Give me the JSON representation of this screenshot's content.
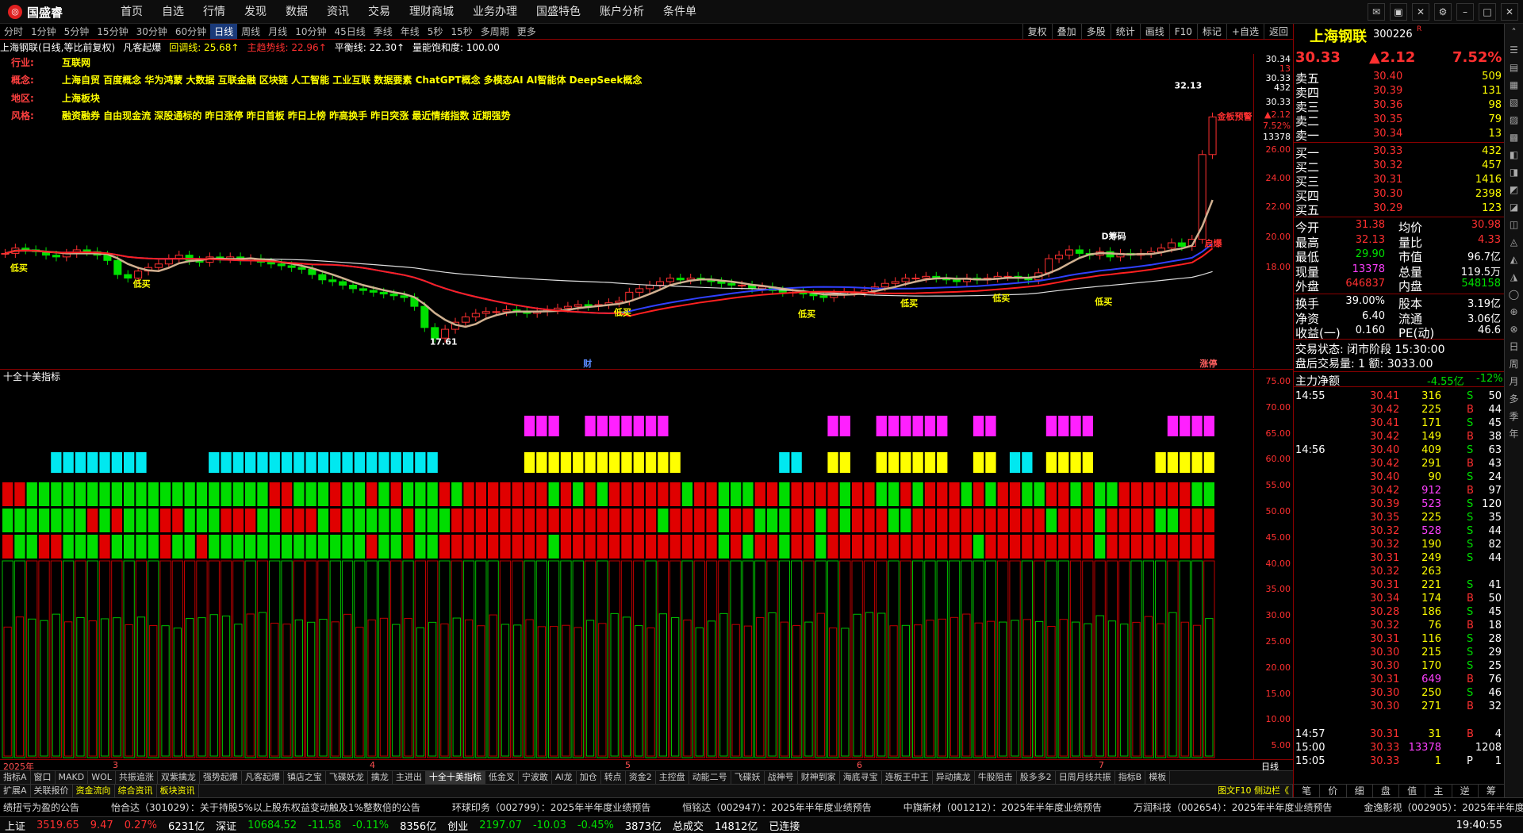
{
  "app": {
    "logo": "国盛睿",
    "menu": [
      "首页",
      "自选",
      "行情",
      "发现",
      "数据",
      "资讯",
      "交易",
      "理财商城",
      "业务办理",
      "国盛特色",
      "账户分析",
      "条件单"
    ]
  },
  "periods": [
    "分时",
    "1分钟",
    "5分钟",
    "15分钟",
    "30分钟",
    "60分钟",
    "日线",
    "周线",
    "月线",
    "10分钟",
    "45日线",
    "季线",
    "年线",
    "5秒",
    "15秒",
    "多周期",
    "更多"
  ],
  "active_period": "日线",
  "right_buttons": [
    "复权",
    "叠加",
    "多股",
    "统计",
    "画线",
    "F10",
    "标记",
    "+自选",
    "返回"
  ],
  "chart_header": {
    "title": "上海钢联(日线,等比前复权)",
    "indicator": "凡客起爆",
    "line1": "回调线: 25.68↑",
    "line2": "主趋势线: 22.96↑",
    "line3": "平衡线: 22.30↑",
    "line4": "量能饱和度: 100.00"
  },
  "info": [
    {
      "label": "行业:",
      "value": "互联网"
    },
    {
      "label": "概念:",
      "value": "上海自贸 百度概念 华为鸿蒙 大数据 互联金融 区块链 人工智能 工业互联 数据要素 ChatGPT概念 多模态AI AI智能体 DeepSeek概念"
    },
    {
      "label": "地区:",
      "value": "上海板块"
    },
    {
      "label": "风格:",
      "value": "融资融券 自由现金流 深股通标的 昨日涨停 昨日首板 昨日上榜 昨高换手 昨日突涨 最近情绪指数 近期强势"
    }
  ],
  "chart_annotations": {
    "high": "32.13",
    "low": "17.61",
    "buy": "低买",
    "chip": "D筹码",
    "start": "启爆",
    "warn": "金板预警",
    "cai": "财",
    "zhang": "涨停"
  },
  "main_axis": [
    "30.34",
    "13",
    "30.33",
    "432",
    "30.33",
    "▲2.12",
    "7.52%",
    "13378",
    "26.00",
    "24.00",
    "22.00",
    "20.00",
    "18.00"
  ],
  "ind_title": "十全十美指标",
  "ind_axis": [
    "75.00",
    "70.00",
    "65.00",
    "60.00",
    "55.00",
    "50.00",
    "45.00",
    "40.00",
    "35.00",
    "30.00",
    "25.00",
    "20.00",
    "15.00",
    "10.00",
    "5.00"
  ],
  "time_axis": [
    "2025年",
    "3",
    "4",
    "5",
    "6",
    "7"
  ],
  "time_right": "日线",
  "bottom_tabs": [
    "指标A",
    "窗口",
    "MAKD",
    "WOL",
    "共振追涨",
    "双紫擒龙",
    "强势起爆",
    "凡客起爆",
    "镇店之宝",
    "飞碟妖龙",
    "擒龙",
    "主进出",
    "十全十美指标",
    "低金叉",
    "宁波敢",
    "AI龙",
    "加仓",
    "转点",
    "资金2",
    "主控盘",
    "动能二号",
    "飞碟妖",
    "战神号",
    "财神到家",
    "海底寻宝",
    "连板王中王",
    "异动擒龙",
    "牛股阻击",
    "股多多2",
    "日周月线共振",
    "指标B",
    "模板"
  ],
  "bottom_tabs_active": "十全十美指标",
  "bottom_tabs2": [
    "扩展A",
    "关联报价",
    "资金流向",
    "综合资讯",
    "板块资讯"
  ],
  "bottom_right": "图文F10 侧边栏《",
  "ticker": [
    "绩扭亏为盈的公告",
    "怡合达（301029）：关于持股5%以上股东权益变动触及1%整数倍的公告",
    "环球印务（002799）：2025年半年度业绩预告",
    "恒铭达（002947）：2025年半年度业绩预告",
    "中旗新材（001212）：2025年半年度业绩预告",
    "万润科技（002654）：2025年半年度业绩预告",
    "金逸影视（002905）：2025年半年度业绩预告"
  ],
  "status": {
    "sh_label": "上证",
    "sh_val": "3519.65",
    "sh_chg": "9.47",
    "sh_pct": "0.27%",
    "sh_amt": "6231亿",
    "sz_label": "深证",
    "sz_val": "10684.52",
    "sz_chg": "-11.58",
    "sz_pct": "-0.11%",
    "sz_amt": "8356亿",
    "cy_label": "创业",
    "cy_val": "2197.07",
    "cy_chg": "-10.03",
    "cy_pct": "-0.45%",
    "cy_amt": "3873亿",
    "total_label": "总成交",
    "total_val": "14812亿",
    "conn": "已连接",
    "time": "19:40:55"
  },
  "quote": {
    "name": "上海钢联",
    "code": "300226",
    "r": "R",
    "price": "30.33",
    "chg": "▲2.12",
    "pct": "7.52%",
    "asks": [
      {
        "l": "卖五",
        "p": "30.40",
        "v": "509"
      },
      {
        "l": "卖四",
        "p": "30.39",
        "v": "131"
      },
      {
        "l": "卖三",
        "p": "30.36",
        "v": "98"
      },
      {
        "l": "卖二",
        "p": "30.35",
        "v": "79"
      },
      {
        "l": "卖一",
        "p": "30.34",
        "v": "13"
      }
    ],
    "bids": [
      {
        "l": "买一",
        "p": "30.33",
        "v": "432"
      },
      {
        "l": "买二",
        "p": "30.32",
        "v": "457"
      },
      {
        "l": "买三",
        "p": "30.31",
        "v": "1416"
      },
      {
        "l": "买四",
        "p": "30.30",
        "v": "2398"
      },
      {
        "l": "买五",
        "p": "30.29",
        "v": "123"
      }
    ],
    "stats": [
      [
        "今开",
        "31.38",
        "均价",
        "30.98"
      ],
      [
        "最高",
        "32.13",
        "量比",
        "4.33"
      ],
      [
        "最低",
        "29.90",
        "市值",
        "96.7亿"
      ],
      [
        "现量",
        "13378",
        "总量",
        "119.5万"
      ],
      [
        "外盘",
        "646837",
        "内盘",
        "548158"
      ]
    ],
    "stats2": [
      [
        "换手",
        "39.00%",
        "股本",
        "3.19亿"
      ],
      [
        "净资",
        "6.40",
        "流通",
        "3.06亿"
      ],
      [
        "收益(一)",
        "0.160",
        "PE(动)",
        "46.6"
      ]
    ],
    "trade_state": "交易状态: 闭市阶段 15:30:00",
    "after_trade": "盘后交易量: 1  额: 3033.00",
    "flow_label": "主力净额",
    "flow_val": "-4.55亿",
    "flow_pct": "-12%"
  },
  "ticks": [
    [
      "14:55",
      "30.41",
      "316",
      "S",
      "50"
    ],
    [
      "",
      "30.42",
      "225",
      "B",
      "44"
    ],
    [
      "",
      "30.41",
      "171",
      "S",
      "45"
    ],
    [
      "",
      "30.42",
      "149",
      "B",
      "38"
    ],
    [
      "14:56",
      "30.40",
      "409",
      "S",
      "63"
    ],
    [
      "",
      "30.42",
      "291",
      "B",
      "43"
    ],
    [
      "",
      "30.40",
      "90",
      "S",
      "24"
    ],
    [
      "",
      "30.42",
      "912",
      "B",
      "97"
    ],
    [
      "",
      "30.39",
      "523",
      "S",
      "120"
    ],
    [
      "",
      "30.35",
      "225",
      "S",
      "35"
    ],
    [
      "",
      "30.32",
      "528",
      "S",
      "44"
    ],
    [
      "",
      "30.32",
      "190",
      "S",
      "82"
    ],
    [
      "",
      "30.31",
      "249",
      "S",
      "44"
    ],
    [
      "",
      "30.32",
      "263",
      "",
      ""
    ],
    [
      "",
      "30.31",
      "221",
      "S",
      "41"
    ],
    [
      "",
      "30.34",
      "174",
      "B",
      "50"
    ],
    [
      "",
      "30.28",
      "186",
      "S",
      "45"
    ],
    [
      "",
      "30.32",
      "76",
      "B",
      "18"
    ],
    [
      "",
      "30.31",
      "116",
      "S",
      "28"
    ],
    [
      "",
      "30.30",
      "215",
      "S",
      "29"
    ],
    [
      "",
      "30.30",
      "170",
      "S",
      "25"
    ],
    [
      "",
      "30.31",
      "649",
      "B",
      "76"
    ],
    [
      "",
      "30.30",
      "250",
      "S",
      "46"
    ],
    [
      "",
      "30.30",
      "271",
      "B",
      "32"
    ],
    [
      "14:57",
      "30.31",
      "31",
      "B",
      "4"
    ],
    [
      "15:00",
      "30.33",
      "13378",
      "",
      "1208"
    ],
    [
      "15:05",
      "30.33",
      "1",
      "P",
      "1"
    ]
  ],
  "rpanel_tabs": [
    "笔",
    "价",
    "细",
    "盘",
    "值",
    "主",
    "逆",
    "筹"
  ],
  "side_icons": [
    "日",
    "周",
    "月",
    "多",
    "季",
    "年"
  ],
  "chart_data": {
    "type": "candlestick",
    "closes": [
      22.6,
      22.9,
      22.8,
      22.7,
      22.5,
      22.4,
      22.6,
      22.8,
      22.7,
      22.5,
      22.2,
      21.4,
      21.2,
      21.6,
      21.8,
      22.0,
      22.3,
      22.5,
      22.2,
      22.1,
      22.4,
      22.3,
      22.4,
      22.2,
      22.3,
      22.1,
      22.0,
      21.9,
      21.8,
      21.7,
      21.4,
      21.1,
      21.0,
      20.8,
      20.6,
      20.5,
      20.4,
      20.3,
      20.2,
      20.1,
      19.6,
      18.4,
      17.8,
      18.3,
      18.7,
      19.0,
      19.2,
      19.3,
      19.3,
      19.4,
      19.3,
      19.2,
      19.3,
      19.4,
      19.5,
      19.6,
      19.7,
      19.6,
      19.7,
      19.8,
      19.9,
      20.4,
      20.6,
      20.8,
      21.0,
      21.2,
      21.1,
      21.2,
      21.1,
      21.0,
      20.9,
      20.8,
      20.8,
      20.6,
      20.7,
      20.5,
      20.4,
      20.4,
      20.3,
      20.2,
      20.1,
      20.3,
      20.4,
      20.4,
      20.5,
      20.7,
      20.9,
      21.0,
      21.2,
      21.2,
      21.3,
      21.2,
      21.1,
      21.0,
      21.2,
      21.1,
      21.2,
      21.3,
      21.3,
      21.2,
      21.1,
      21.5,
      22.3,
      22.5,
      22.8,
      22.6,
      22.5,
      22.7,
      22.4,
      22.6,
      22.5,
      22.6,
      22.7,
      22.9,
      23.2,
      23.0,
      23.4,
      28.2,
      30.33
    ],
    "ylim": [
      17.0,
      33.0
    ]
  }
}
